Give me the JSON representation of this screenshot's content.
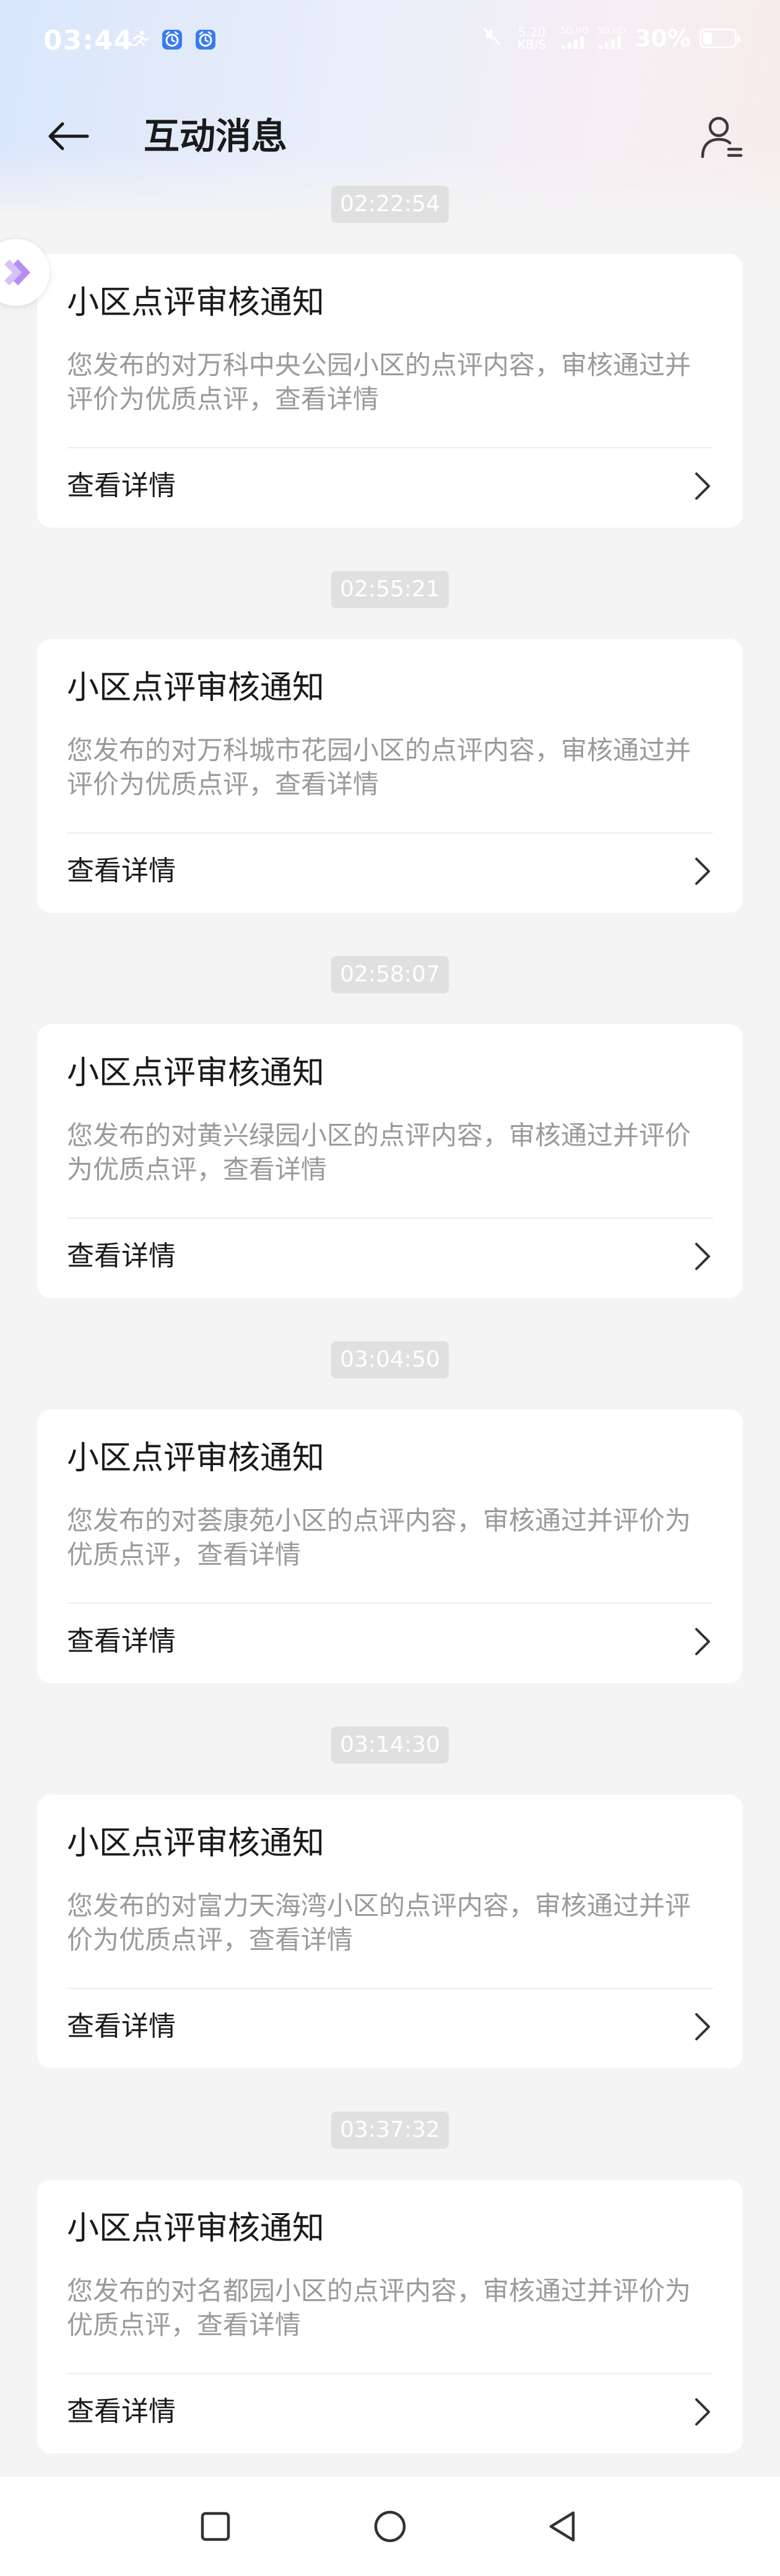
{
  "status_bar": {
    "time": "03:44",
    "net_speed_value": "5.20",
    "net_speed_unit": "KB/S",
    "sim1_label": "5G HD",
    "sim2_label": "5G HD",
    "battery_percent": "30%",
    "battery_level": 0.3
  },
  "header": {
    "title": "互动消息"
  },
  "messages": [
    {
      "timestamp": "02:22:54",
      "title": "小区点评审核通知",
      "body": "您发布的对万科中央公园小区的点评内容，审核通过并评价为优质点评，查看详情",
      "link": "查看详情"
    },
    {
      "timestamp": "02:55:21",
      "title": "小区点评审核通知",
      "body": "您发布的对万科城市花园小区的点评内容，审核通过并评价为优质点评，查看详情",
      "link": "查看详情"
    },
    {
      "timestamp": "02:58:07",
      "title": "小区点评审核通知",
      "body": "您发布的对黄兴绿园小区的点评内容，审核通过并评价为优质点评，查看详情",
      "link": "查看详情"
    },
    {
      "timestamp": "03:04:50",
      "title": "小区点评审核通知",
      "body": "您发布的对荟康苑小区的点评内容，审核通过并评价为优质点评，查看详情",
      "link": "查看详情"
    },
    {
      "timestamp": "03:14:30",
      "title": "小区点评审核通知",
      "body": "您发布的对富力天海湾小区的点评内容，审核通过并评价为优质点评，查看详情",
      "link": "查看详情"
    },
    {
      "timestamp": "03:37:32",
      "title": "小区点评审核通知",
      "body": "您发布的对名都园小区的点评内容，审核通过并评价为优质点评，查看详情",
      "link": "查看详情"
    }
  ],
  "icons": {
    "back": "arrow-left-icon",
    "user": "user-settings-icon",
    "chevron": "chevron-right-icon",
    "nav_recent": "square-icon",
    "nav_home": "circle-icon",
    "nav_back": "triangle-back-icon"
  },
  "colors": {
    "accent_purple": "#b58ff0",
    "status_icon_blue": "#3a7af0"
  }
}
